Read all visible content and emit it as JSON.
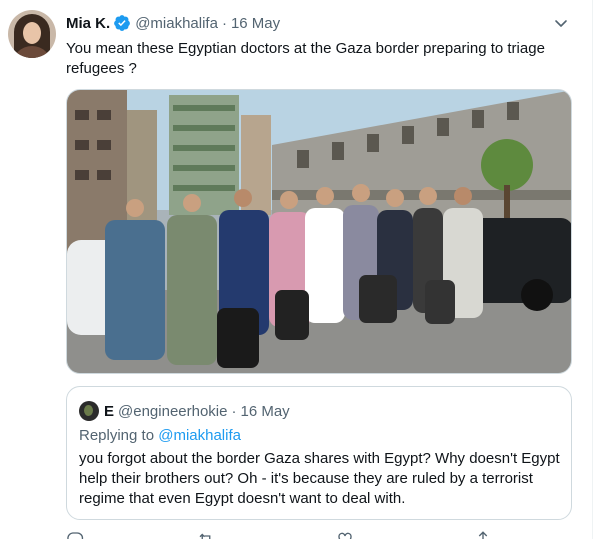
{
  "tweet": {
    "author_name": "Mia K.",
    "author_handle": "@miakhalifa",
    "separator": "·",
    "date": "16 May",
    "text": "You mean these Egyptian doctors at the Gaza border preparing to triage refugees ?",
    "image_alt": "Group of people with masks and luggage standing on a street"
  },
  "quote": {
    "author_name": "E",
    "author_handle": "@engineerhokie",
    "separator": "·",
    "date": "16 May",
    "replying_label": "Replying to ",
    "replying_to": "@miakhalifa",
    "text": "you forgot about the border Gaza shares with Egypt? Why doesn't Egypt help their brothers out? Oh - it's because they are ruled by a terrorist regime that even Egypt doesn't want to deal with."
  },
  "icons": {
    "verified": "verified-badge-icon",
    "more": "chevron-down-icon",
    "actions": [
      "reply-icon",
      "retweet-icon",
      "like-icon",
      "share-icon"
    ]
  },
  "colors": {
    "accent": "#1d9bf0",
    "secondary_text": "#536471",
    "border": "#cfd9de"
  }
}
